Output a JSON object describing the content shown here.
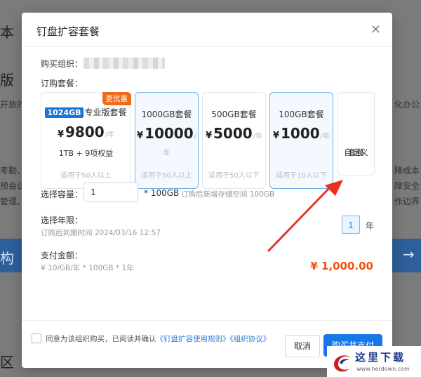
{
  "background": {
    "left_texts": [
      "本",
      "版",
      "开放的",
      "考勤、",
      "预会议",
      "管理、",
      "区"
    ],
    "right_texts": [
      "化办公",
      "降成本",
      "障安全",
      "作边界"
    ],
    "band_left_char": "构"
  },
  "modal": {
    "title": "钉盘扩容套餐",
    "close_icon": "close-icon",
    "org_label": "购买组织：",
    "plan_label": "订购套餐：",
    "plans": [
      {
        "badge": "1024GB",
        "name": "专业版套餐",
        "price": "9800",
        "unit": "/年",
        "extra": "1TB + 9项权益",
        "note": "适用于50人以上",
        "corner": "更优惠",
        "selected": false
      },
      {
        "name": "1000GB套餐",
        "price": "10000",
        "unit": "/年",
        "note": "适用于50人以上",
        "selected": true
      },
      {
        "name": "500GB套餐",
        "price": "5000",
        "unit": "/年",
        "note": "适用于50人以下",
        "selected": false
      },
      {
        "name": "100GB套餐",
        "price": "1000",
        "unit": "/年",
        "note": "适用于10人以下",
        "selected": true
      }
    ],
    "yen": "¥",
    "custom_plan": "自定义\n套餐",
    "custom_line1": "自定义",
    "custom_line2": "套餐",
    "capacity_label": "选择容量：",
    "capacity_value": "1",
    "capacity_unit": "* 100GB",
    "capacity_note": "订购后新增存储空间 100GB",
    "year_label": "选择年限：",
    "expire_note": "订购后到期时间 2024/03/16 12:57",
    "year_value": "1",
    "year_unit": "年",
    "amount_label": "支付金额：",
    "amount_formula": "¥ 10/GB/年 * 100GB * 1年",
    "total": "¥ 1,000.00",
    "agree_prefix": "同意为该组织购买，已阅读并确认",
    "agree_link1": "《钉盘扩容使用规则》",
    "agree_link2": "《组织协议》",
    "cancel": "取消",
    "buy": "购买并支付"
  },
  "watermark": {
    "main": "这里下载",
    "sub": "www.herdown.com"
  },
  "colors": {
    "accent": "#1677e8",
    "price": "#f0520f",
    "badge_orange": "#f06a1d",
    "annotation_arrow": "#e8321e"
  }
}
